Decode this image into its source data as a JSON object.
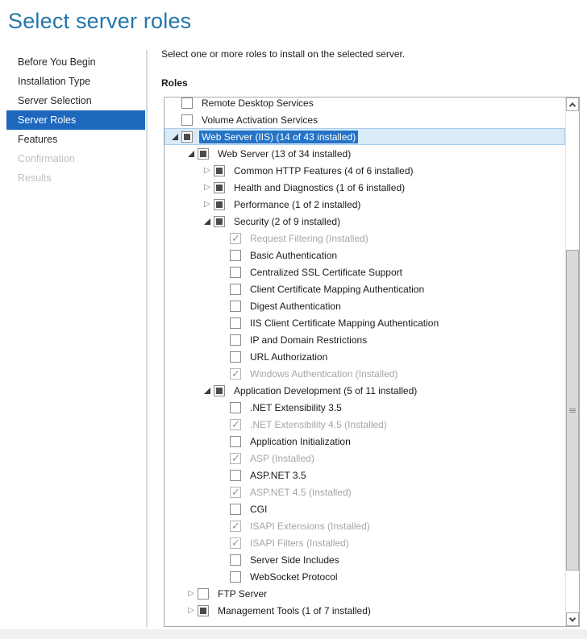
{
  "page": {
    "title": "Select server roles"
  },
  "colors": {
    "title_blue": "#2276ac",
    "nav_selected_bg": "#1d68bd",
    "selection_bg": "#2473c8",
    "selection_row_bg": "#d9eaf8",
    "selection_row_border": "#a7cdee",
    "disabled_text": "#a6a6a6",
    "border_gray": "#ababab"
  },
  "sidebar": {
    "items": [
      {
        "label": "Before You Begin",
        "state": "normal"
      },
      {
        "label": "Installation Type",
        "state": "normal"
      },
      {
        "label": "Server Selection",
        "state": "normal"
      },
      {
        "label": "Server Roles",
        "state": "selected"
      },
      {
        "label": "Features",
        "state": "normal"
      },
      {
        "label": "Confirmation",
        "state": "disabled"
      },
      {
        "label": "Results",
        "state": "disabled"
      }
    ]
  },
  "main": {
    "instruction": "Select one or more roles to install on the selected server.",
    "roles_label": "Roles",
    "tree": {
      "rows": [
        {
          "level": 0,
          "arrow": "none",
          "checkbox": "unchecked",
          "label": "Remote Desktop Services"
        },
        {
          "level": 0,
          "arrow": "none",
          "checkbox": "unchecked",
          "label": "Volume Activation Services"
        },
        {
          "level": 0,
          "arrow": "expanded",
          "checkbox": "indeterminate",
          "label": "Web Server (IIS) (14 of 43 installed)",
          "selected": true
        },
        {
          "level": 1,
          "arrow": "expanded",
          "checkbox": "indeterminate",
          "label": "Web Server (13 of 34 installed)"
        },
        {
          "level": 2,
          "arrow": "collapsed",
          "checkbox": "indeterminate",
          "label": "Common HTTP Features (4 of 6 installed)"
        },
        {
          "level": 2,
          "arrow": "collapsed",
          "checkbox": "indeterminate",
          "label": "Health and Diagnostics (1 of 6 installed)"
        },
        {
          "level": 2,
          "arrow": "collapsed",
          "checkbox": "indeterminate",
          "label": "Performance (1 of 2 installed)"
        },
        {
          "level": 2,
          "arrow": "expanded",
          "checkbox": "indeterminate",
          "label": "Security (2 of 9 installed)"
        },
        {
          "level": 3,
          "arrow": "none",
          "checkbox": "checked",
          "disabled": true,
          "label": "Request Filtering (Installed)"
        },
        {
          "level": 3,
          "arrow": "none",
          "checkbox": "unchecked",
          "label": "Basic Authentication"
        },
        {
          "level": 3,
          "arrow": "none",
          "checkbox": "unchecked",
          "label": "Centralized SSL Certificate Support"
        },
        {
          "level": 3,
          "arrow": "none",
          "checkbox": "unchecked",
          "label": "Client Certificate Mapping Authentication"
        },
        {
          "level": 3,
          "arrow": "none",
          "checkbox": "unchecked",
          "label": "Digest Authentication"
        },
        {
          "level": 3,
          "arrow": "none",
          "checkbox": "unchecked",
          "label": "IIS Client Certificate Mapping Authentication"
        },
        {
          "level": 3,
          "arrow": "none",
          "checkbox": "unchecked",
          "label": "IP and Domain Restrictions"
        },
        {
          "level": 3,
          "arrow": "none",
          "checkbox": "unchecked",
          "label": "URL Authorization"
        },
        {
          "level": 3,
          "arrow": "none",
          "checkbox": "checked",
          "disabled": true,
          "label": "Windows Authentication (Installed)"
        },
        {
          "level": 2,
          "arrow": "expanded",
          "checkbox": "indeterminate",
          "label": "Application Development (5 of 11 installed)"
        },
        {
          "level": 3,
          "arrow": "none",
          "checkbox": "unchecked",
          "label": ".NET Extensibility 3.5"
        },
        {
          "level": 3,
          "arrow": "none",
          "checkbox": "checked",
          "disabled": true,
          "label": ".NET Extensibility 4.5 (Installed)"
        },
        {
          "level": 3,
          "arrow": "none",
          "checkbox": "unchecked",
          "label": "Application Initialization"
        },
        {
          "level": 3,
          "arrow": "none",
          "checkbox": "checked",
          "disabled": true,
          "label": "ASP (Installed)"
        },
        {
          "level": 3,
          "arrow": "none",
          "checkbox": "unchecked",
          "label": "ASP.NET 3.5"
        },
        {
          "level": 3,
          "arrow": "none",
          "checkbox": "checked",
          "disabled": true,
          "label": "ASP.NET 4.5 (Installed)"
        },
        {
          "level": 3,
          "arrow": "none",
          "checkbox": "unchecked",
          "label": "CGI"
        },
        {
          "level": 3,
          "arrow": "none",
          "checkbox": "checked",
          "disabled": true,
          "label": "ISAPI Extensions (Installed)"
        },
        {
          "level": 3,
          "arrow": "none",
          "checkbox": "checked",
          "disabled": true,
          "label": "ISAPI Filters (Installed)"
        },
        {
          "level": 3,
          "arrow": "none",
          "checkbox": "unchecked",
          "label": "Server Side Includes"
        },
        {
          "level": 3,
          "arrow": "none",
          "checkbox": "unchecked",
          "label": "WebSocket Protocol"
        },
        {
          "level": 1,
          "arrow": "collapsed",
          "checkbox": "unchecked",
          "label": "FTP Server"
        },
        {
          "level": 1,
          "arrow": "collapsed",
          "checkbox": "indeterminate",
          "label": "Management Tools (1 of 7 installed)"
        }
      ]
    },
    "scrollbar": {
      "up_icon": "chevron-up-icon",
      "down_icon": "chevron-down-icon",
      "thumb_icon": "gripper-icon"
    }
  }
}
